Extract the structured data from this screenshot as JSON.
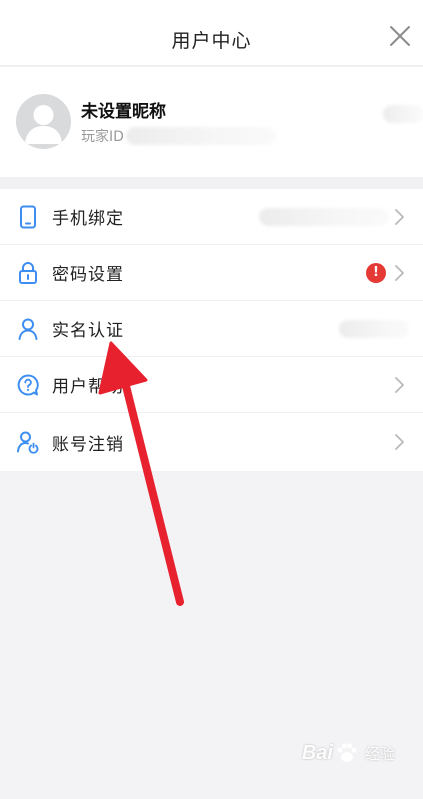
{
  "header": {
    "title": "用户中心"
  },
  "profile": {
    "nickname": "未设置昵称",
    "player_id_label": "玩家ID"
  },
  "menu": {
    "items": [
      {
        "key": "phone",
        "label": "手机绑定",
        "icon": "phone-icon"
      },
      {
        "key": "password",
        "label": "密码设置",
        "icon": "lock-icon",
        "badge": "!"
      },
      {
        "key": "realname",
        "label": "实名认证",
        "icon": "person-icon"
      },
      {
        "key": "help",
        "label": "用户帮助",
        "icon": "help-icon"
      },
      {
        "key": "cancel",
        "label": "账号注销",
        "icon": "user-power-icon"
      }
    ]
  },
  "watermark": {
    "brand_a": "Bai",
    "brand_b": "经验"
  },
  "colors": {
    "accent_icon": "#3d8ef0",
    "badge": "#e53935",
    "annotation_arrow": "#e8212e",
    "background": "#f3f3f5"
  }
}
